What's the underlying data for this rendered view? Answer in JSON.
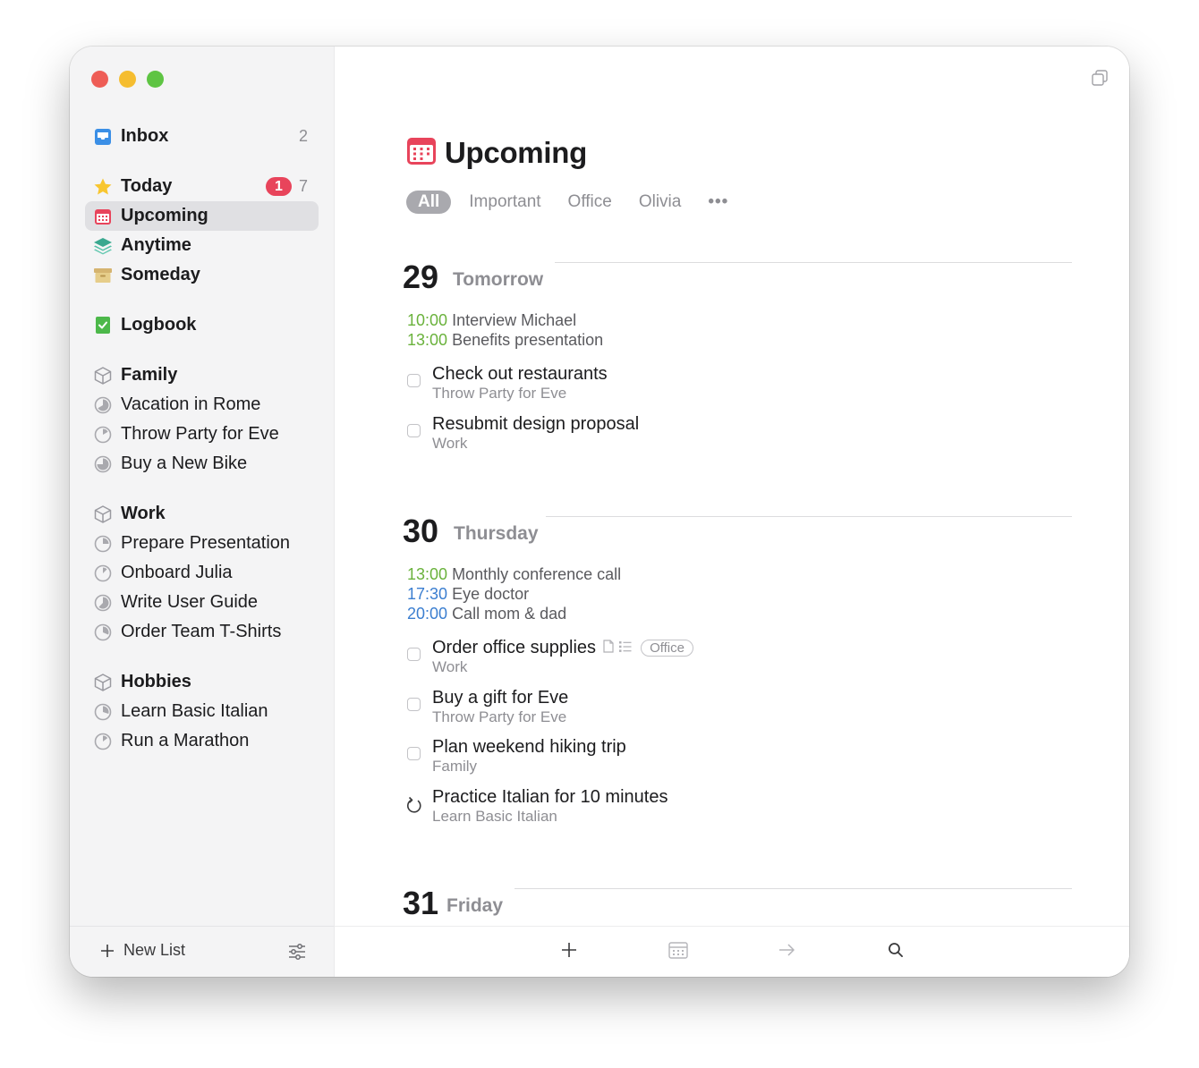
{
  "sidebar": {
    "inbox": {
      "label": "Inbox",
      "count": "2"
    },
    "today": {
      "label": "Today",
      "badge": "1",
      "count": "7"
    },
    "upcoming": {
      "label": "Upcoming"
    },
    "anytime": {
      "label": "Anytime"
    },
    "someday": {
      "label": "Someday"
    },
    "logbook": {
      "label": "Logbook"
    },
    "areas": [
      {
        "name": "Family",
        "projects": [
          "Vacation in Rome",
          "Throw Party for Eve",
          "Buy a New Bike"
        ]
      },
      {
        "name": "Work",
        "projects": [
          "Prepare Presentation",
          "Onboard Julia",
          "Write User Guide",
          "Order Team T-Shirts"
        ]
      },
      {
        "name": "Hobbies",
        "projects": [
          "Learn Basic Italian",
          "Run a Marathon"
        ]
      }
    ],
    "footer": {
      "new_list": "New List"
    }
  },
  "main": {
    "title": "Upcoming",
    "filters": [
      "All",
      "Important",
      "Office",
      "Olivia"
    ],
    "more": "•••",
    "sections": [
      {
        "num": "29",
        "name": "Tomorrow",
        "events": [
          {
            "time": "10:00",
            "title": "Interview Michael",
            "color": "#6ab23c"
          },
          {
            "time": "13:00",
            "title": "Benefits presentation",
            "color": "#6ab23c"
          }
        ],
        "tasks": [
          {
            "title": "Check out restaurants",
            "sub": "Throw Party for Eve"
          },
          {
            "title": "Resubmit design proposal",
            "sub": "Work"
          }
        ]
      },
      {
        "num": "30",
        "name": "Thursday",
        "events": [
          {
            "time": "13:00",
            "title": "Monthly conference call",
            "color": "#6ab23c"
          },
          {
            "time": "17:30",
            "title": "Eye doctor",
            "color": "#3b7ed0"
          },
          {
            "time": "20:00",
            "title": "Call mom & dad",
            "color": "#3b7ed0"
          }
        ],
        "tasks": [
          {
            "title": "Order office supplies",
            "sub": "Work",
            "tag": "Office"
          },
          {
            "title": "Buy a gift for Eve",
            "sub": "Throw Party for Eve"
          },
          {
            "title": "Plan weekend hiking trip",
            "sub": "Family"
          },
          {
            "title": "Practice Italian for 10 minutes",
            "sub": "Learn Basic Italian",
            "repeating": true
          }
        ]
      },
      {
        "num": "31",
        "name": "Friday"
      }
    ]
  },
  "colors": {
    "accent_red": "#e8445b",
    "inbox_blue": "#3b8fe6",
    "logbook_green": "#4cb84a",
    "event_green": "#6ab23c",
    "event_blue": "#3b7ed0"
  }
}
